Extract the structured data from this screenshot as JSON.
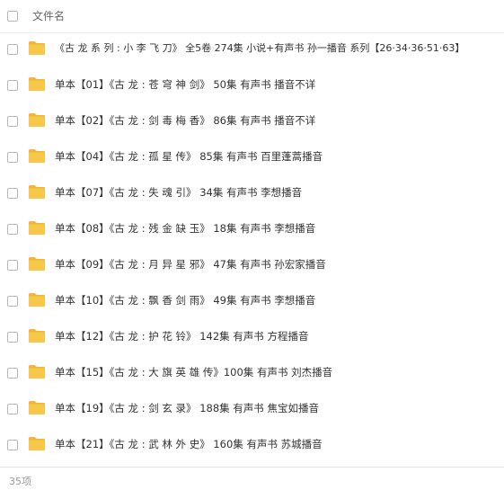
{
  "header": {
    "column_label": "文件名"
  },
  "files": [
    {
      "name": "《古 龙 系 列 : 小 李 飞 刀》 全5卷 274集 小说+有声书 孙一播音 系列【26·34·36·51·63】",
      "icon": "folder-icon"
    },
    {
      "name": "单本【01】《古 龙 : 苍 穹 神 剑》 50集 有声书 播音不详",
      "icon": "folder-icon"
    },
    {
      "name": "单本【02】《古 龙 : 剑 毒 梅 香》 86集 有声书 播音不详",
      "icon": "folder-icon"
    },
    {
      "name": "单本【04】《古 龙 : 孤 星 传》 85集 有声书 百里蓬蒿播音",
      "icon": "folder-icon"
    },
    {
      "name": "单本【07】《古 龙 : 失 魂 引》 34集 有声书 李想播音",
      "icon": "folder-icon"
    },
    {
      "name": "单本【08】《古 龙 : 残 金 缺 玉》 18集 有声书 李想播音",
      "icon": "folder-icon"
    },
    {
      "name": "单本【09】《古 龙 : 月 异 星 邪》 47集 有声书 孙宏家播音",
      "icon": "folder-icon"
    },
    {
      "name": "单本【10】《古 龙 : 飘 香 剑 雨》 49集 有声书 李想播音",
      "icon": "folder-icon"
    },
    {
      "name": "单本【12】《古 龙 : 护 花 铃》 142集 有声书 方程播音",
      "icon": "folder-icon"
    },
    {
      "name": "单本【15】《古 龙 : 大 旗 英 雄 传》100集 有声书 刘杰播音",
      "icon": "folder-icon"
    },
    {
      "name": "单本【19】《古 龙 : 剑 玄 录》 188集 有声书 焦宝如播音",
      "icon": "folder-icon"
    },
    {
      "name": "单本【21】《古 龙 : 武 林 外 史》 160集 有声书 苏城播音",
      "icon": "folder-icon"
    }
  ],
  "footer": {
    "count_label": "35项"
  },
  "colors": {
    "folder": "#f7c74a",
    "folder_tab": "#f2b632",
    "text": "#333333",
    "muted": "#999999"
  }
}
